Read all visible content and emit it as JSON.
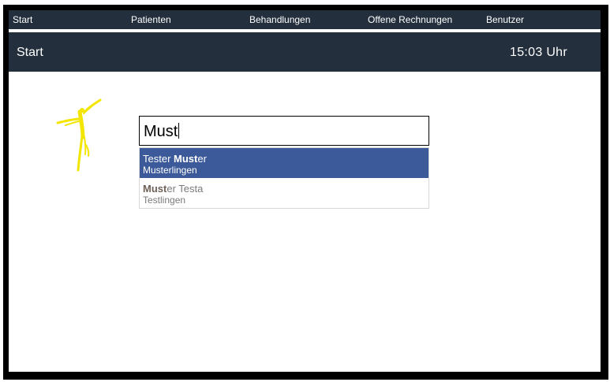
{
  "nav": {
    "items": [
      "Start",
      "Patienten",
      "Behandlungen",
      "Offene Rechnungen",
      "Benutzer"
    ]
  },
  "header": {
    "title": "Start",
    "time": "15:03 Uhr"
  },
  "logo": {
    "icon": "dancer-logo-icon",
    "color": "#f2e600"
  },
  "search": {
    "value": "Must"
  },
  "suggestions": [
    {
      "name_prefix": "Tester ",
      "name_match": "Must",
      "name_rest": "er",
      "place": "Musterlingen",
      "selected": true
    },
    {
      "name_prefix": "",
      "name_match": "Must",
      "name_rest": "er Testa",
      "place": "Testlingen",
      "selected": false
    }
  ],
  "colors": {
    "header_bg": "#232f3d",
    "selected_bg": "#3c5a9a",
    "frame": "#000000"
  }
}
